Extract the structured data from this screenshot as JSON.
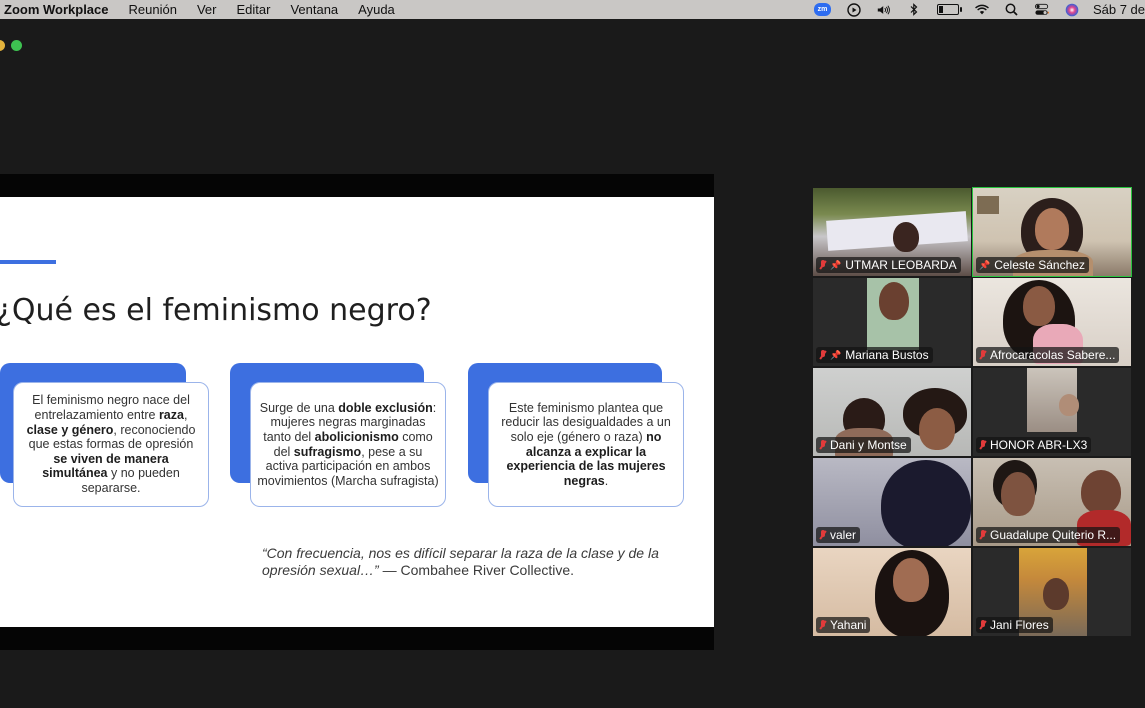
{
  "menubar": {
    "app_name": "Zoom Workplace",
    "menus": [
      "Reunión",
      "Ver",
      "Editar",
      "Ventana",
      "Ayuda"
    ],
    "zoom_badge": "zm",
    "clock": "Sáb 7 de",
    "icons": [
      "zoom-status-icon",
      "play-circle-icon",
      "volume-icon",
      "bluetooth-icon",
      "battery-icon",
      "wifi-icon",
      "search-icon",
      "control-center-icon",
      "siri-icon"
    ]
  },
  "slide": {
    "title": "¿Qué es el feminismo negro?",
    "cards": [
      {
        "parts": [
          {
            "t": "El feminismo negro nace del entrelazamiento entre ",
            "b": false
          },
          {
            "t": "raza",
            "b": true
          },
          {
            "t": ", ",
            "b": false
          },
          {
            "t": "clase y género",
            "b": true
          },
          {
            "t": ", reconociendo que estas formas de opresión ",
            "b": false
          },
          {
            "t": "se viven de manera simultánea",
            "b": true
          },
          {
            "t": " y no pueden separarse.",
            "b": false
          }
        ]
      },
      {
        "parts": [
          {
            "t": "Surge de una ",
            "b": false
          },
          {
            "t": "doble exclusión",
            "b": true
          },
          {
            "t": ": mujeres negras marginadas tanto del ",
            "b": false
          },
          {
            "t": "abolicionismo",
            "b": true
          },
          {
            "t": " como del ",
            "b": false
          },
          {
            "t": "sufragismo",
            "b": true
          },
          {
            "t": ", pese a su activa participación en ambos movimientos (Marcha sufragista)",
            "b": false
          }
        ]
      },
      {
        "parts": [
          {
            "t": "Este feminismo plantea que reducir las desigualdades a un solo eje (género o raza) ",
            "b": false
          },
          {
            "t": "no alcanza a explicar la experiencia de las mujeres negras",
            "b": true
          },
          {
            "t": ".",
            "b": false
          }
        ]
      }
    ],
    "quote_text": "“Con frecuencia, nos es difícil separar la raza de la clase y de la opresión sexual…”",
    "quote_attribution": " — Combahee River Collective."
  },
  "participants": [
    {
      "name": "UTMAR LEOBARDA",
      "muted": true,
      "pinned": true,
      "active": false
    },
    {
      "name": "Celeste Sánchez",
      "muted": false,
      "pinned": true,
      "active": true
    },
    {
      "name": "Mariana Bustos",
      "muted": true,
      "pinned": true,
      "active": false
    },
    {
      "name": "Afrocaracolas Sabere...",
      "muted": true,
      "pinned": false,
      "active": false
    },
    {
      "name": "Dani y Montse",
      "muted": true,
      "pinned": false,
      "active": false
    },
    {
      "name": "HONOR ABR-LX3",
      "muted": true,
      "pinned": false,
      "active": false
    },
    {
      "name": "valer",
      "muted": true,
      "pinned": false,
      "active": false
    },
    {
      "name": "Guadalupe Quiterio R...",
      "muted": true,
      "pinned": false,
      "active": false
    },
    {
      "name": "Yahani",
      "muted": true,
      "pinned": false,
      "active": false
    },
    {
      "name": "Jani Flores",
      "muted": true,
      "pinned": false,
      "active": false
    }
  ]
}
